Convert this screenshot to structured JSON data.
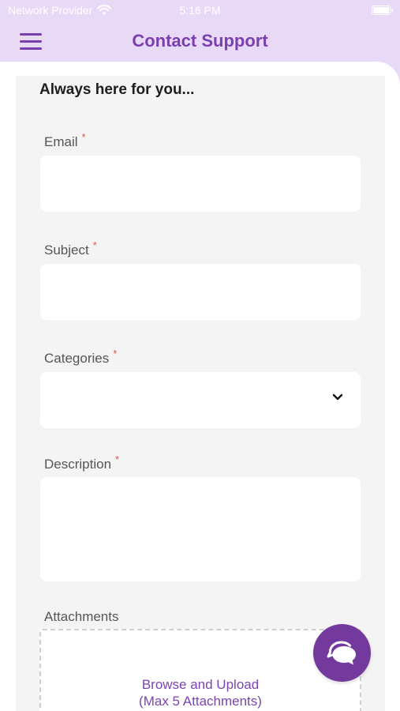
{
  "status_bar": {
    "carrier": "Network Provider",
    "time": "5:16 PM",
    "wifi_icon": "wifi-icon",
    "battery_icon": "battery-icon"
  },
  "header": {
    "menu_icon": "hamburger-menu-icon",
    "title": "Contact Support"
  },
  "form": {
    "heading": "Always here for you...",
    "required_mark": "*",
    "email": {
      "label": "Email",
      "value": "",
      "placeholder": ""
    },
    "subject": {
      "label": "Subject",
      "value": "",
      "placeholder": ""
    },
    "categories": {
      "label": "Categories",
      "selected": "",
      "icon": "chevron-down-icon"
    },
    "description": {
      "label": "Description",
      "value": "",
      "placeholder": ""
    },
    "attachments": {
      "label": "Attachments",
      "upload_line1": "Browse and Upload",
      "upload_line2": "(Max 5 Attachments)"
    }
  },
  "chat_fab": {
    "icon": "chat-bubbles-icon"
  },
  "colors": {
    "header_bg": "#e8d9f7",
    "accent": "#7b3fb0",
    "fab_bg": "#74399c",
    "required": "#e0524c",
    "panel_bg": "#f4f4f4"
  }
}
